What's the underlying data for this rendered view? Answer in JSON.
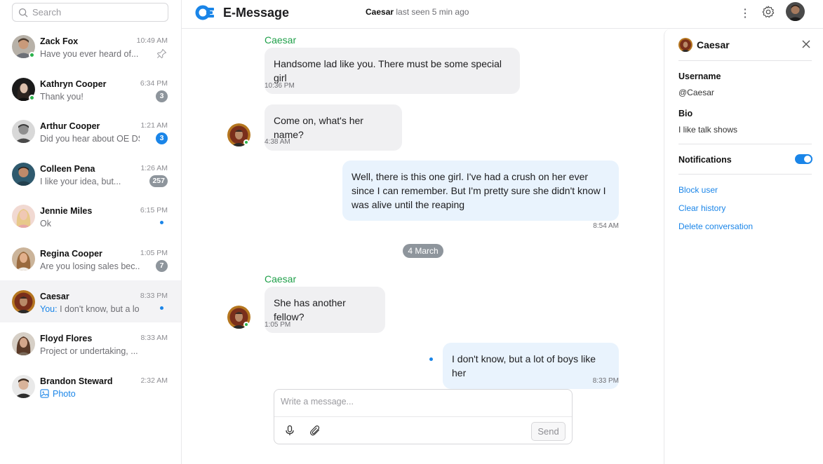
{
  "search": {
    "placeholder": "Search"
  },
  "sidebar": {
    "chats": [
      {
        "name": "Zack Fox",
        "time": "10:49 AM",
        "preview": "Have you ever heard of...",
        "online": true,
        "pinned": true
      },
      {
        "name": "Kathryn Cooper",
        "time": "6:34 PM",
        "preview": "Thank you!",
        "online": true,
        "badge": "3",
        "badge_color": "gray"
      },
      {
        "name": "Arthur Cooper",
        "time": "1:21 AM",
        "preview": "Did you hear about OE DS..",
        "badge": "3",
        "badge_color": "blue"
      },
      {
        "name": "Colleen Pena",
        "time": "1:26 AM",
        "preview": "I like your idea, but...",
        "badge": "257",
        "badge_color": "gray"
      },
      {
        "name": "Jennie Miles",
        "time": "6:15 PM",
        "preview": "Ok",
        "unread_dot": true
      },
      {
        "name": "Regina Cooper",
        "time": "1:05 PM",
        "preview": "Are you losing sales bec...",
        "badge": "7",
        "badge_color": "gray"
      },
      {
        "name": "Caesar",
        "time": "8:33 PM",
        "preview_prefix": "You:",
        "preview": "I don't know, but a lo...",
        "unread_dot": true,
        "active": true
      },
      {
        "name": "Floyd Flores",
        "time": "8:33 AM",
        "preview": "Project or undertaking, ..."
      },
      {
        "name": "Brandon Steward",
        "time": "2:32 AM",
        "preview": "Photo",
        "preview_icon": "image-icon"
      }
    ]
  },
  "header": {
    "app_title": "E-Message",
    "contact_name": "Caesar",
    "contact_status": "last seen 5 min ago",
    "icons": [
      "more-vertical-icon",
      "gear-icon",
      "user-avatar"
    ]
  },
  "conversation": {
    "messages": [
      {
        "sender": "Caesar",
        "text": "Handsome lad like you. There must be some special girl",
        "time": "10:36 PM",
        "direction": "in"
      },
      {
        "text": "Come on, what's her name?",
        "time": "4:38 AM",
        "direction": "in"
      },
      {
        "text": "Well, there is this one girl. I've had a crush on her ever since I can remember. But I'm pretty sure she didn't know I was alive until the reaping",
        "time": "8:54 AM",
        "direction": "out"
      },
      {
        "sender": "Caesar",
        "text": "She has another fellow?",
        "time": "1:05 PM",
        "direction": "in"
      },
      {
        "text": "I don't know, but a lot of boys like her",
        "time": "8:33 PM",
        "direction": "out"
      }
    ],
    "date_separator": "4 March"
  },
  "composer": {
    "placeholder": "Write a message...",
    "send_label": "Send"
  },
  "details": {
    "name": "Caesar",
    "username_label": "Username",
    "username": "@Caesar",
    "bio_label": "Bio",
    "bio": "I like talk shows",
    "notifications_label": "Notifications",
    "notifications_on": true,
    "actions": [
      "Block user",
      "Clear history",
      "Delete conversation"
    ]
  },
  "colors": {
    "accent": "#1a85e8",
    "online": "#2bb24c",
    "sender": "#20a04a",
    "badge_gray": "#8e959c",
    "bubble_in": "#f0f0f2",
    "bubble_out": "#e9f3fd"
  }
}
